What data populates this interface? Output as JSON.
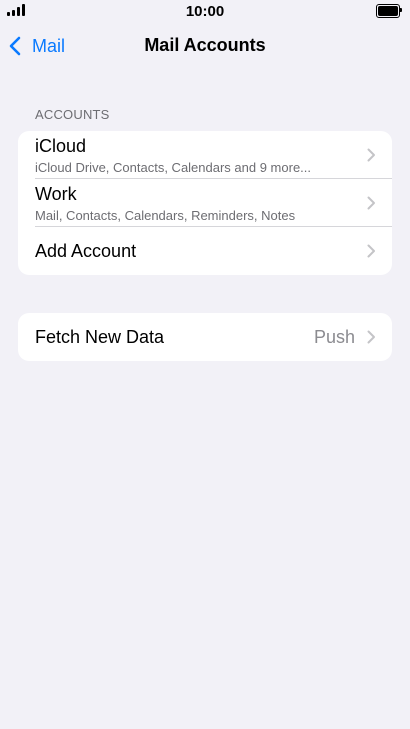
{
  "status_bar": {
    "time": "10:00"
  },
  "nav": {
    "back_label": "Mail",
    "title": "Mail Accounts"
  },
  "accounts_section": {
    "header": "ACCOUNTS",
    "items": [
      {
        "title": "iCloud",
        "subtitle": "iCloud Drive, Contacts, Calendars and 9 more..."
      },
      {
        "title": "Work",
        "subtitle": "Mail, Contacts, Calendars, Reminders, Notes"
      },
      {
        "title": "Add Account"
      }
    ]
  },
  "fetch_section": {
    "title": "Fetch New Data",
    "value": "Push"
  },
  "colors": {
    "accent": "#0a7aff",
    "background": "#f2f1f7",
    "secondary_text": "#6d6d72"
  },
  "icons": {
    "back": "chevron-left-icon",
    "row": "chevron-right-icon",
    "signal": "signal-icon",
    "battery": "battery-icon"
  }
}
